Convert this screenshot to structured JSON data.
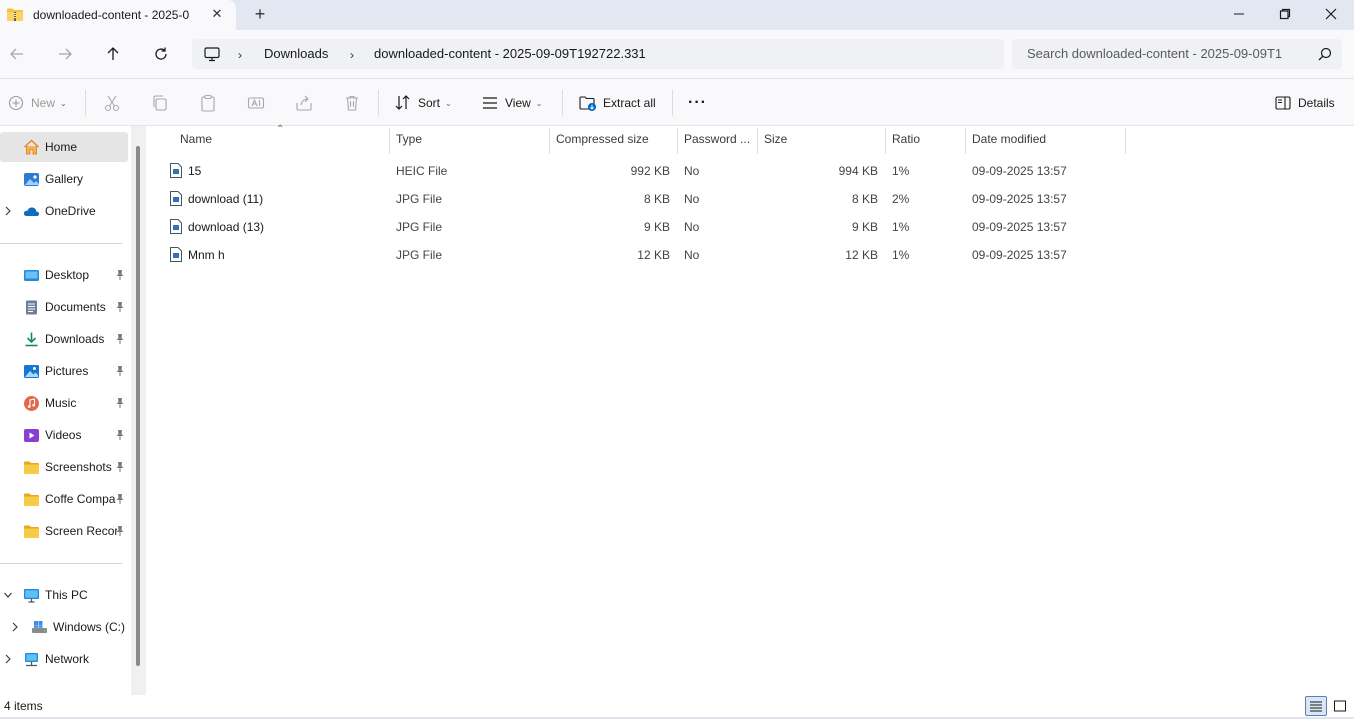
{
  "window": {
    "tab_title": "downloaded-content - 2025-0",
    "close_tab_glyph": "✕",
    "new_tab_glyph": "+"
  },
  "address": {
    "breadcrumbs": [
      "Downloads",
      "downloaded-content - 2025-09-09T192722.331"
    ],
    "search_placeholder": "Search downloaded-content - 2025-09-09T1"
  },
  "toolbar": {
    "new": "New",
    "sort": "Sort",
    "view": "View",
    "extract_all": "Extract all",
    "more": "···",
    "details": "Details"
  },
  "sidebar": {
    "home": "Home",
    "gallery": "Gallery",
    "onedrive": "OneDrive",
    "quick": [
      "Desktop",
      "Documents",
      "Downloads",
      "Pictures",
      "Music",
      "Videos",
      "Screenshots",
      "Coffe Compa",
      "Screen Recor"
    ],
    "this_pc": "This PC",
    "windows_c": "Windows (C:)",
    "network": "Network"
  },
  "columns": {
    "name": "Name",
    "type": "Type",
    "compressed_size": "Compressed size",
    "password": "Password ...",
    "size": "Size",
    "ratio": "Ratio",
    "date_modified": "Date modified"
  },
  "files": [
    {
      "name": "15",
      "type": "HEIC File",
      "compressed": "992 KB",
      "password": "No",
      "size": "994 KB",
      "ratio": "1%",
      "date": "09-09-2025 13:57"
    },
    {
      "name": "download (11)",
      "type": "JPG File",
      "compressed": "8 KB",
      "password": "No",
      "size": "8 KB",
      "ratio": "2%",
      "date": "09-09-2025 13:57"
    },
    {
      "name": "download (13)",
      "type": "JPG File",
      "compressed": "9 KB",
      "password": "No",
      "size": "9 KB",
      "ratio": "1%",
      "date": "09-09-2025 13:57"
    },
    {
      "name": "Mnm h",
      "type": "JPG File",
      "compressed": "12 KB",
      "password": "No",
      "size": "12 KB",
      "ratio": "1%",
      "date": "09-09-2025 13:57"
    }
  ],
  "status": {
    "items_count": "4 items"
  },
  "colors": {
    "accent": "#0067c0",
    "titlebar": "#e3e7f2",
    "folder_yellow": "#f5c344",
    "selected_bg": "#e5e5e5"
  },
  "icons": {
    "back": "arrow-left-icon",
    "forward": "arrow-right-icon",
    "up": "arrow-up-icon",
    "refresh": "refresh-icon",
    "search": "search-icon",
    "cut": "scissors-icon",
    "copy": "copy-icon",
    "paste": "clipboard-icon",
    "rename": "rename-icon",
    "share": "share-icon",
    "delete": "trash-icon"
  }
}
